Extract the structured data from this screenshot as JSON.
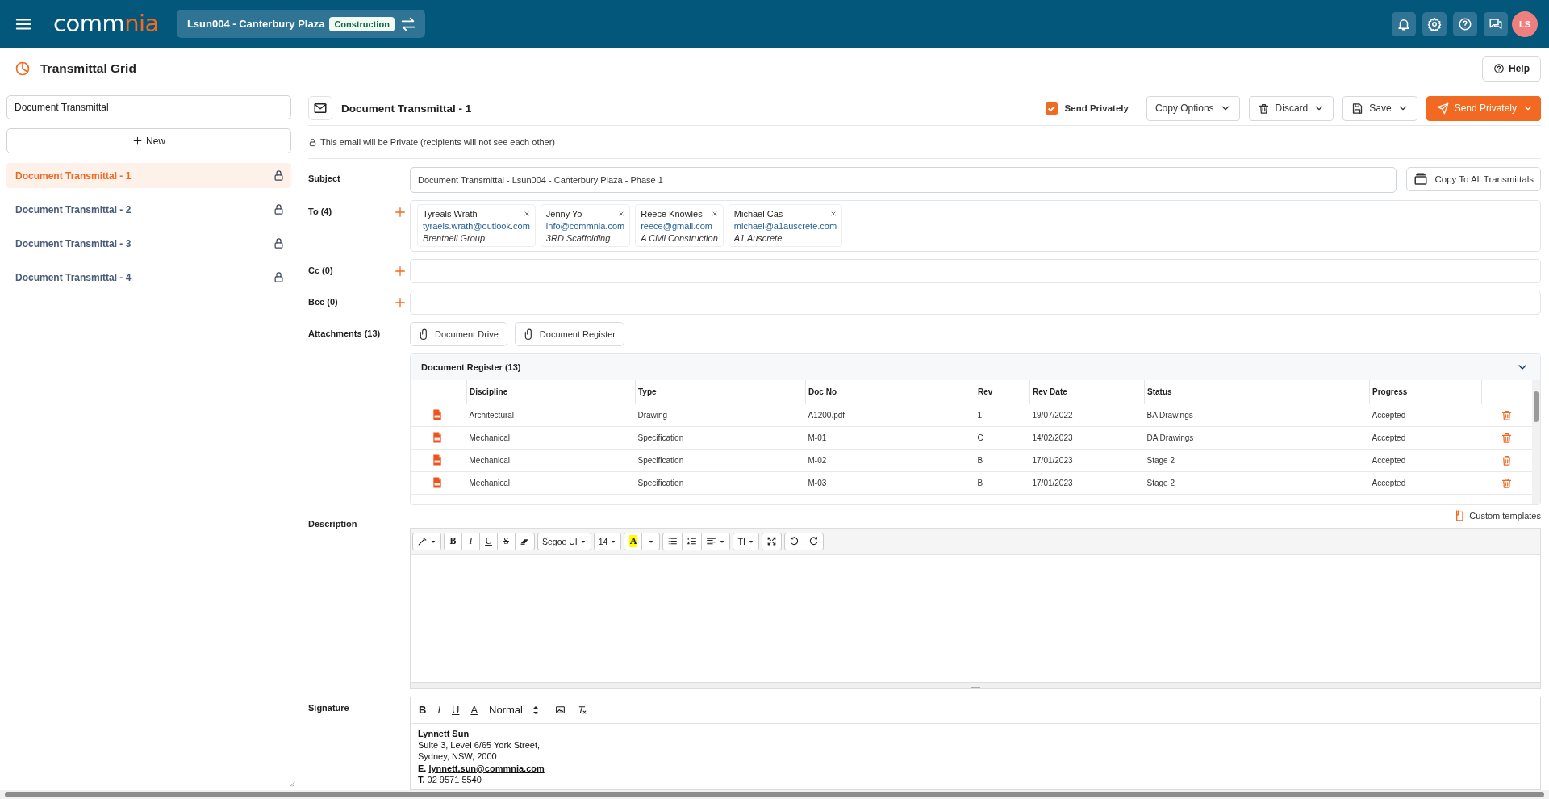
{
  "header": {
    "logo": [
      "comm",
      "nia"
    ],
    "project": "Lsun004 - Canterbury Plaza",
    "project_tag": "Construction",
    "avatar": "LS"
  },
  "page": {
    "title": "Transmittal Grid",
    "help": "Help"
  },
  "sidebar": {
    "search_value": "Document Transmittal",
    "new_button": "New",
    "items": [
      {
        "label": "Document Transmittal - 1",
        "selected": true
      },
      {
        "label": "Document Transmittal - 2",
        "selected": false
      },
      {
        "label": "Document Transmittal - 3",
        "selected": false
      },
      {
        "label": "Document Transmittal - 4",
        "selected": false
      }
    ]
  },
  "composer": {
    "title": "Document Transmittal - 1",
    "send_privately": {
      "label": "Send Privately",
      "checked": true
    },
    "actions": [
      {
        "label": "Copy Options",
        "kind": "menu"
      },
      {
        "label": "Discard",
        "kind": "discard"
      },
      {
        "label": "Save",
        "kind": "save"
      },
      {
        "label": "Send Privately",
        "kind": "send"
      }
    ],
    "notice": "This email will be Private (recipients will not see each other)",
    "subject": {
      "label": "Subject",
      "value": "Document Transmittal - Lsun004 - Canterbury Plaza - Phase 1",
      "copy_button": "Copy To All Transmittals"
    },
    "recipients": [
      {
        "label": "To (4)",
        "contacts": [
          {
            "name": "Tyreals Wrath",
            "email": "tyraels.wrath@outlook.com",
            "company": "Brentnell Group"
          },
          {
            "name": "Jenny Yo",
            "email": "info@commnia.com",
            "company": "3RD Scaffolding"
          },
          {
            "name": "Reece Knowles",
            "email": "reece@gmail.com",
            "company": "A Civil Construction"
          },
          {
            "name": "Michael Cas",
            "email": "michael@a1auscrete.com",
            "company": "A1 Auscrete"
          }
        ]
      },
      {
        "label": "Cc (0)"
      },
      {
        "label": "Bcc (0)"
      }
    ],
    "attachments": {
      "label": "Attachments (13)",
      "buttons": [
        "Document Drive",
        "Document Register"
      ],
      "register": {
        "title": "Document Register (13)",
        "expanded": true,
        "columns": [
          "Discipline",
          "Type",
          "Doc No",
          "Rev",
          "Rev Date",
          "Status",
          "Progress"
        ],
        "rows": [
          [
            "Architectural",
            "Drawing",
            "A1200.pdf",
            "1",
            "19/07/2022",
            "BA Drawings",
            "Accepted"
          ],
          [
            "Mechanical",
            "Specification",
            "M-01",
            "C",
            "14/02/2023",
            "DA Drawings",
            "Accepted"
          ],
          [
            "Mechanical",
            "Specification",
            "M-02",
            "B",
            "17/01/2023",
            "Stage 2",
            "Accepted"
          ],
          [
            "Mechanical",
            "Specification",
            "M-03",
            "B",
            "17/01/2023",
            "Stage 2",
            "Accepted"
          ]
        ]
      }
    },
    "description": {
      "label": "Description",
      "templates": "Custom templates",
      "toolbar": [
        [
          {
            "kind": "wand",
            "dropdown": true
          }
        ],
        [
          {
            "kind": "bold",
            "text": "B"
          },
          {
            "kind": "italic",
            "text": "I"
          },
          {
            "kind": "underline",
            "text": "U"
          },
          {
            "kind": "strike",
            "text": "S"
          },
          {
            "kind": "eraser"
          }
        ],
        [
          {
            "kind": "glyph",
            "text": "Segoe UI",
            "dropdown": true
          }
        ],
        [
          {
            "kind": "glyph",
            "text": "14",
            "dropdown": true
          }
        ],
        [
          {
            "kind": "highlight",
            "text": "A"
          },
          {
            "kind": "caret"
          }
        ],
        [
          {
            "kind": "bullets"
          },
          {
            "kind": "numbers"
          },
          {
            "kind": "align",
            "dropdown": true
          }
        ],
        [
          {
            "kind": "glyph",
            "text": "TI",
            "dropdown": true
          }
        ],
        [
          {
            "kind": "fullscreen"
          }
        ],
        [
          {
            "kind": "undo"
          },
          {
            "kind": "redo"
          }
        ]
      ]
    },
    "signature": {
      "label": "Signature",
      "toolbar": [
        {
          "kind": "bold",
          "text": "B"
        },
        {
          "kind": "italic",
          "text": "I"
        },
        {
          "kind": "underline",
          "text": "U"
        },
        {
          "kind": "color",
          "text": "A"
        },
        {
          "kind": "select",
          "text": "Normal"
        },
        {
          "kind": "image"
        },
        {
          "kind": "clear"
        }
      ],
      "lines": [
        {
          "kind": "name",
          "text": "Lynnett Sun"
        },
        {
          "kind": "text",
          "text": "Suite 3, Level 6/65 York Street,"
        },
        {
          "kind": "text",
          "text": "Sydney, NSW, 2000"
        },
        {
          "kind": "email",
          "prefix": "E.",
          "text": "lynnett.sun@commnia.com"
        },
        {
          "kind": "phone",
          "prefix": "T.",
          "text": "02 9571 5540"
        }
      ]
    }
  }
}
